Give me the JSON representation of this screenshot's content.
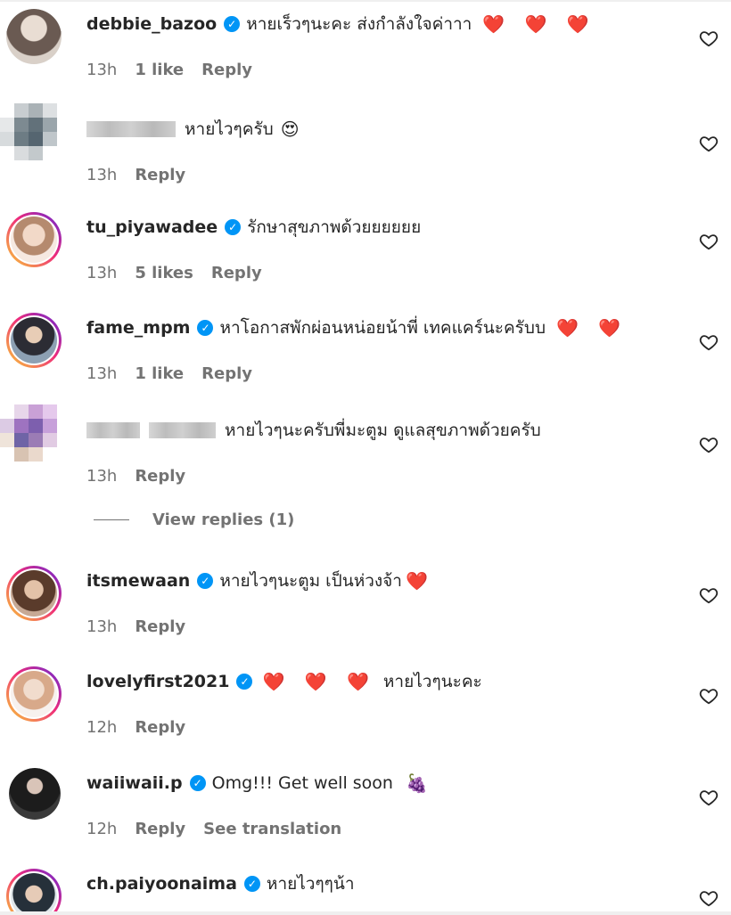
{
  "comments": [
    {
      "username": "debbie_bazoo",
      "verified": true,
      "text": "หายเร็วๆนะคะ ส่งกำลังใจค่าาา",
      "emoji": "❤️ ❤️ ❤️",
      "time": "13h",
      "likes": "1 like",
      "reply": "Reply"
    },
    {
      "username": "",
      "verified": false,
      "text": "หายไวๆครับ",
      "emoji": "😍",
      "time": "13h",
      "likes": "",
      "reply": "Reply"
    },
    {
      "username": "tu_piyawadee",
      "verified": true,
      "text": "รักษาสุขภาพด้วยยยยยย",
      "emoji": "",
      "time": "13h",
      "likes": "5 likes",
      "reply": "Reply"
    },
    {
      "username": "fame_mpm",
      "verified": true,
      "text": "หาโอกาสพักผ่อนหน่อยน้าพี่ เทคแคร์นะครับบ",
      "emoji": "❤️ ❤️",
      "time": "13h",
      "likes": "1 like",
      "reply": "Reply"
    },
    {
      "username": "",
      "verified": false,
      "text": "หายไวๆนะครับพี่มะตูม ดูแลสุขภาพด้วยครับ",
      "emoji": "",
      "time": "13h",
      "likes": "",
      "reply": "Reply"
    },
    {
      "username": "itsmewaan",
      "verified": true,
      "text": "หายไวๆนะตูม เป็นห่วงจ้า",
      "emoji": "❤️",
      "time": "13h",
      "likes": "",
      "reply": "Reply"
    },
    {
      "username": "lovelyfirst2021",
      "verified": true,
      "text": "หายไวๆนะคะ",
      "emoji": "❤️ ❤️ ❤️",
      "time": "12h",
      "likes": "",
      "reply": "Reply"
    },
    {
      "username": "waiiwaii.p",
      "verified": true,
      "text": "Omg!!! Get well soon",
      "emoji": "🍇",
      "time": "12h",
      "likes": "",
      "reply": "Reply",
      "translate": "See translation"
    },
    {
      "username": "ch.paiyoonaima",
      "verified": true,
      "text": "หายไวๆๆน้า",
      "emoji": "",
      "time": "",
      "likes": "",
      "reply": ""
    }
  ],
  "view_replies": "View replies (1)",
  "colors": {
    "text": "#262626",
    "muted": "#737373",
    "verified": "#0095f6",
    "heart_emoji": "#ed4956"
  },
  "icons": {
    "like": "heart-outline-icon",
    "verified": "verified-badge-icon"
  }
}
